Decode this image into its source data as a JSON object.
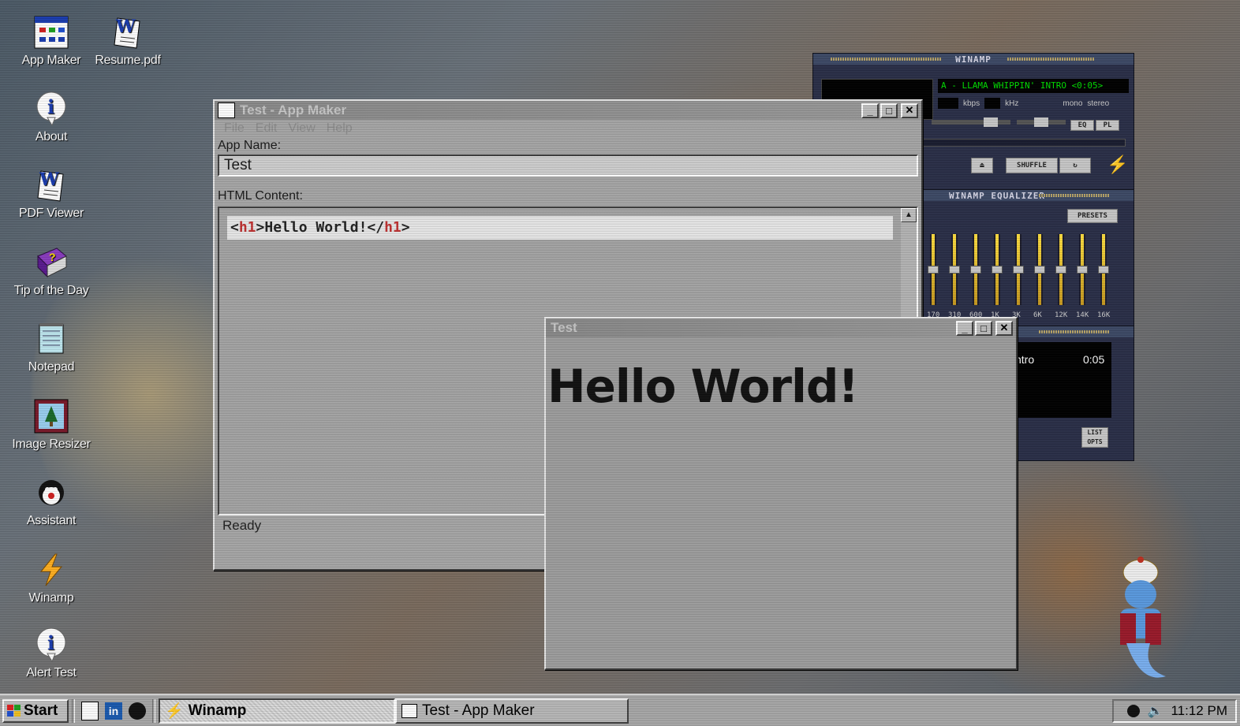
{
  "desktop_icons": [
    {
      "label": "App Maker",
      "icon": "app-maker-icon"
    },
    {
      "label": "Resume.pdf",
      "icon": "word-document-icon"
    },
    {
      "label": "About",
      "icon": "info-icon"
    },
    {
      "label": "PDF Viewer",
      "icon": "word-document-icon"
    },
    {
      "label": "Tip of the Day",
      "icon": "help-book-icon"
    },
    {
      "label": "Notepad",
      "icon": "notepad-icon"
    },
    {
      "label": "Image Resizer",
      "icon": "image-icon"
    },
    {
      "label": "Assistant",
      "icon": "assistant-icon"
    },
    {
      "label": "Winamp",
      "icon": "winamp-icon"
    },
    {
      "label": "Alert Test",
      "icon": "info-icon"
    }
  ],
  "appmaker": {
    "title": "Test - App Maker",
    "menu": [
      "File",
      "Edit",
      "View",
      "Help"
    ],
    "app_name_label": "App Name:",
    "app_name_value": "Test",
    "html_label": "HTML Content:",
    "code_open": "<",
    "code_tag": "h1",
    "code_mid": ">Hello World!</",
    "code_tag2": "h1",
    "code_close": ">",
    "status": "Ready",
    "btn_min": "_",
    "btn_max": "□",
    "btn_close": "✕"
  },
  "preview": {
    "title": "Test",
    "heading": "Hello World!"
  },
  "winamp": {
    "title": "WINAMP",
    "track": "A - LLAMA WHIPPIN' INTRO <0:05>",
    "kbps": "kbps",
    "khz": "kHz",
    "mono": "mono",
    "stereo": "stereo",
    "eq_btn": "EQ",
    "pl_btn": "PL",
    "shuffle": "SHUFFLE",
    "eq_title": "WINAMP EQUALIZER",
    "presets": "PRESETS",
    "eq_bands": [
      "170",
      "310",
      "600",
      "1K",
      "3K",
      "6K",
      "12K",
      "14K",
      "16K"
    ],
    "playlist_track": "ntro",
    "playlist_time": "0:05",
    "list_opts": "LIST OPTS"
  },
  "taskbar": {
    "start": "Start",
    "tasks": [
      {
        "label": "Winamp",
        "active": true
      },
      {
        "label": "Test - App Maker",
        "active": false
      }
    ],
    "clock": "11:12 PM"
  },
  "colors": {
    "accent_green": "#00e000",
    "tag_red": "#c03030",
    "winamp_panel": "#2a2f48"
  }
}
